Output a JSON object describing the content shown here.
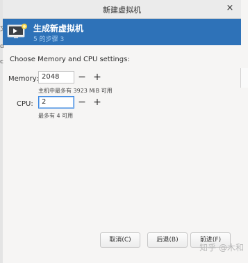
{
  "window": {
    "title": "新建虚拟机",
    "close_glyph": "×"
  },
  "header": {
    "title": "生成新虚拟机",
    "subtitle": "5 的步骤 3",
    "icon": "monitor-icon"
  },
  "page": {
    "section_title": "Choose Memory and CPU settings:",
    "memory": {
      "label": "Memory:",
      "value": "2048",
      "hint": "主机中最多有 3923 MiB 可用"
    },
    "cpu": {
      "label": "CPU:",
      "value": "2",
      "hint": "最多有 4 可用"
    },
    "spin_minus": "−",
    "spin_plus": "+"
  },
  "buttons": {
    "cancel": "取消(C)",
    "back": "后退(B)",
    "forward": "前进(F)"
  },
  "watermark": "知乎 @木和",
  "colors": {
    "header_bg": "#2e72b8",
    "focus": "#3584e4"
  }
}
